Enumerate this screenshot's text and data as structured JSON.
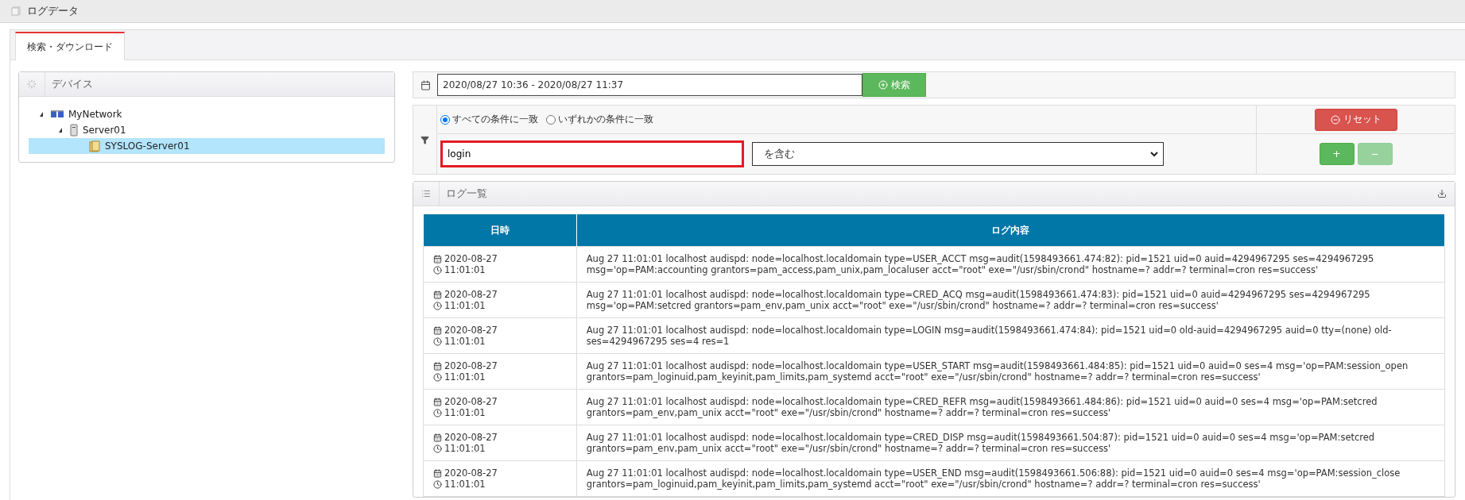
{
  "window": {
    "title": "ログデータ"
  },
  "tabs": [
    {
      "label": "検索・ダウンロード",
      "selected": true
    }
  ],
  "device_panel": {
    "title": "デバイス",
    "tree": [
      {
        "label": "MyNetwork",
        "kind": "network",
        "expanded": true,
        "selected": false,
        "children": [
          {
            "label": "Server01",
            "kind": "server",
            "expanded": true,
            "selected": false,
            "children": [
              {
                "label": "SYSLOG-Server01",
                "kind": "log",
                "selected": true
              }
            ]
          }
        ]
      }
    ]
  },
  "search": {
    "date_range": "2020/08/27 10:36 - 2020/08/27 11:37",
    "button": "検索"
  },
  "filter": {
    "match_options": [
      {
        "label": "すべての条件に一致",
        "selected": true
      },
      {
        "label": "いずれかの条件に一致",
        "selected": false
      }
    ],
    "reset_button": "リセット",
    "condition": {
      "value": "login",
      "operator": "を含む"
    },
    "add_button": {
      "label": "+",
      "disabled": false
    },
    "remove_button": {
      "label": "−",
      "disabled": true
    }
  },
  "log_panel": {
    "title": "ログ一覧",
    "columns": [
      "日時",
      "ログ内容"
    ],
    "rows": [
      {
        "date": "2020-08-27",
        "time": "11:01:01",
        "message": "Aug 27 11:01:01 localhost audispd: node=localhost.localdomain type=USER_ACCT msg=audit(1598493661.474:82): pid=1521 uid=0 auid=4294967295 ses=4294967295 msg='op=PAM:accounting grantors=pam_access,pam_unix,pam_localuser acct=\"root\" exe=\"/usr/sbin/crond\" hostname=? addr=? terminal=cron res=success'"
      },
      {
        "date": "2020-08-27",
        "time": "11:01:01",
        "message": "Aug 27 11:01:01 localhost audispd: node=localhost.localdomain type=CRED_ACQ msg=audit(1598493661.474:83): pid=1521 uid=0 auid=4294967295 ses=4294967295 msg='op=PAM:setcred grantors=pam_env,pam_unix acct=\"root\" exe=\"/usr/sbin/crond\" hostname=? addr=? terminal=cron res=success'"
      },
      {
        "date": "2020-08-27",
        "time": "11:01:01",
        "message": "Aug 27 11:01:01 localhost audispd: node=localhost.localdomain type=LOGIN msg=audit(1598493661.474:84): pid=1521 uid=0 old-auid=4294967295 auid=0 tty=(none) old-ses=4294967295 ses=4 res=1"
      },
      {
        "date": "2020-08-27",
        "time": "11:01:01",
        "message": "Aug 27 11:01:01 localhost audispd: node=localhost.localdomain type=USER_START msg=audit(1598493661.484:85): pid=1521 uid=0 auid=0 ses=4 msg='op=PAM:session_open grantors=pam_loginuid,pam_keyinit,pam_limits,pam_systemd acct=\"root\" exe=\"/usr/sbin/crond\" hostname=? addr=? terminal=cron res=success'"
      },
      {
        "date": "2020-08-27",
        "time": "11:01:01",
        "message": "Aug 27 11:01:01 localhost audispd: node=localhost.localdomain type=CRED_REFR msg=audit(1598493661.484:86): pid=1521 uid=0 auid=0 ses=4 msg='op=PAM:setcred grantors=pam_env,pam_unix acct=\"root\" exe=\"/usr/sbin/crond\" hostname=? addr=? terminal=cron res=success'"
      },
      {
        "date": "2020-08-27",
        "time": "11:01:01",
        "message": "Aug 27 11:01:01 localhost audispd: node=localhost.localdomain type=CRED_DISP msg=audit(1598493661.504:87): pid=1521 uid=0 auid=0 ses=4 msg='op=PAM:setcred grantors=pam_env,pam_unix acct=\"root\" exe=\"/usr/sbin/crond\" hostname=? addr=? terminal=cron res=success'"
      },
      {
        "date": "2020-08-27",
        "time": "11:01:01",
        "message": "Aug 27 11:01:01 localhost audispd: node=localhost.localdomain type=USER_END msg=audit(1598493661.506:88): pid=1521 uid=0 auid=0 ses=4 msg='op=PAM:session_close grantors=pam_loginuid,pam_keyinit,pam_limits,pam_systemd acct=\"root\" exe=\"/usr/sbin/crond\" hostname=? addr=? terminal=cron res=success'"
      }
    ]
  }
}
